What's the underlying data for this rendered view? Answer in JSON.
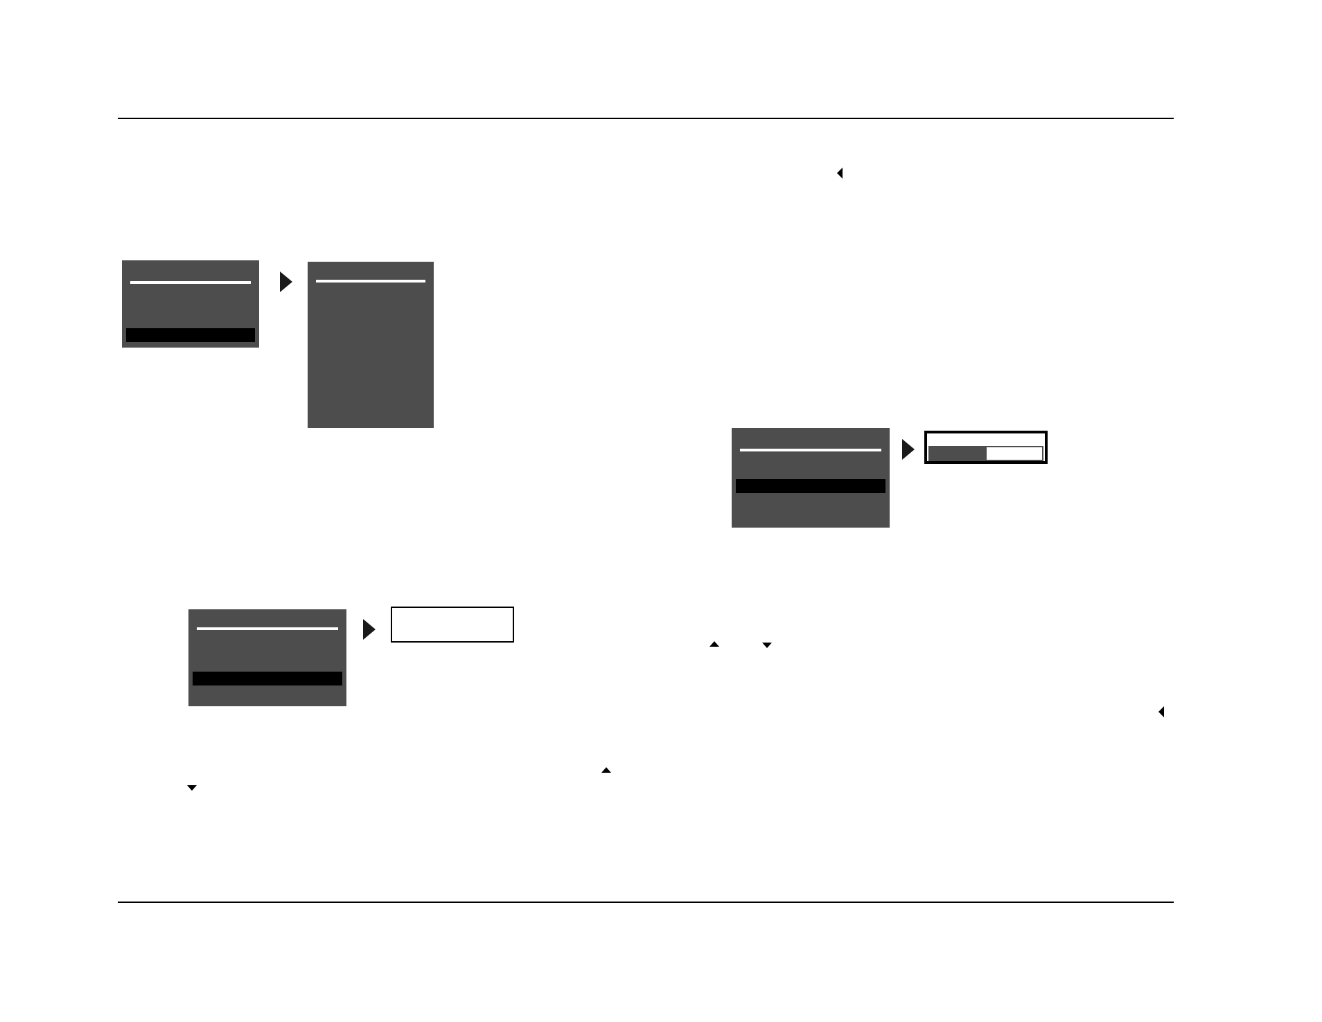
{
  "diagrams": [
    {
      "screens": [
        {
          "kind": "menu",
          "rows": [
            {
              "selected": false
            },
            {
              "selected": false
            },
            {
              "selected": false
            },
            {
              "selected": true
            }
          ]
        },
        {
          "kind": "menu"
        }
      ]
    },
    {
      "screens": [
        {
          "kind": "menu",
          "rows": [
            {
              "selected": false
            },
            {
              "selected": false
            },
            {
              "selected": false
            },
            {
              "selected": true
            },
            {
              "selected": false
            }
          ]
        },
        {
          "kind": "text_box"
        }
      ]
    },
    {
      "screens": [
        {
          "kind": "menu",
          "rows": [
            {
              "selected": false
            },
            {
              "selected": false
            },
            {
              "selected": true
            },
            {
              "selected": false
            },
            {
              "selected": false
            }
          ]
        },
        {
          "kind": "level_box",
          "level": 0.5
        }
      ]
    }
  ]
}
